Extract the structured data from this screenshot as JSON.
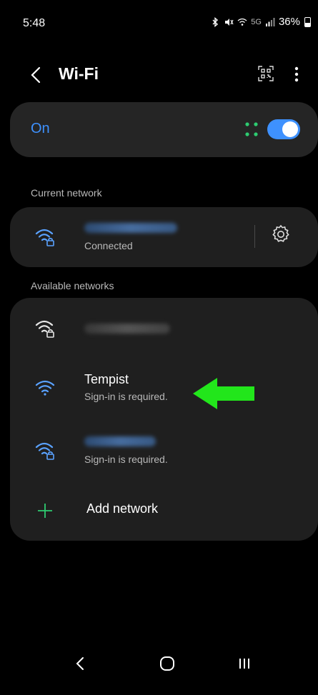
{
  "status_bar": {
    "time": "5:48",
    "network_type": "5G",
    "battery": "36%"
  },
  "header": {
    "title": "Wi-Fi",
    "back_icon": "chevron-left-icon",
    "qr_icon": "qr-code-icon",
    "more_icon": "more-vertical-icon"
  },
  "wifi_toggle": {
    "label": "On",
    "state": "on"
  },
  "current_network": {
    "heading": "Current network",
    "status": "Connected",
    "icon": "wifi-lock-icon",
    "settings_icon": "gear-icon"
  },
  "available_networks": {
    "heading": "Available networks",
    "items": [
      {
        "status": "",
        "secured": true
      },
      {
        "name": "Tempist",
        "status": "Sign-in is required.",
        "secured": false
      },
      {
        "status": "Sign-in is required.",
        "secured": true
      }
    ],
    "add_label": "Add network"
  },
  "colors": {
    "accent": "#3e91ff",
    "card": "#1f1f1f",
    "annotation_arrow": "#22e61b",
    "plus": "#2ecc71"
  }
}
